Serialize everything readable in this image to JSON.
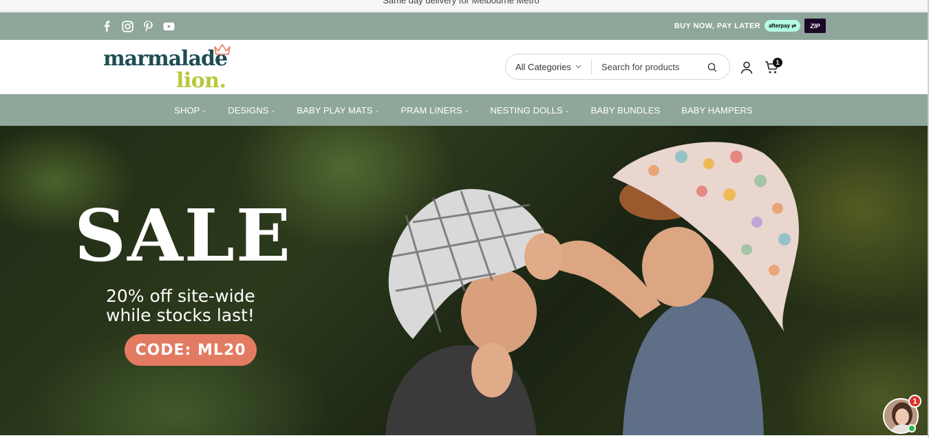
{
  "announcement": {
    "text": "Same day delivery for Melbourne Metro"
  },
  "utility_bar": {
    "social_icons": [
      "facebook-icon",
      "instagram-icon",
      "pinterest-icon",
      "youtube-icon"
    ],
    "bnpl_text": "BUY NOW, PAY LATER",
    "afterpay_label": "afterpay",
    "zip_label": "ZIP"
  },
  "header": {
    "logo_line1": "marmalade",
    "logo_line2": "lion.",
    "search": {
      "category_label": "All Categories",
      "placeholder": "Search for products"
    },
    "cart_count": "1"
  },
  "nav": {
    "items": [
      {
        "label": "SHOP",
        "has_dropdown": true
      },
      {
        "label": "DESIGNS",
        "has_dropdown": true
      },
      {
        "label": "BABY PLAY MATS",
        "has_dropdown": true
      },
      {
        "label": "PRAM LINERS",
        "has_dropdown": true
      },
      {
        "label": "NESTING DOLLS",
        "has_dropdown": true
      },
      {
        "label": "BABY BUNDLES",
        "has_dropdown": false
      },
      {
        "label": "BABY HAMPERS",
        "has_dropdown": false
      }
    ]
  },
  "hero": {
    "headline": "SALE",
    "line1": "20% off site-wide",
    "line2": "while stocks last!",
    "code_label": "CODE: ML20"
  },
  "chat": {
    "badge_count": "1"
  },
  "colors": {
    "sage": "#8fa69a",
    "logo_teal": "#1e4d52",
    "logo_lime": "#b7c83a",
    "code_coral": "#e37b62"
  }
}
